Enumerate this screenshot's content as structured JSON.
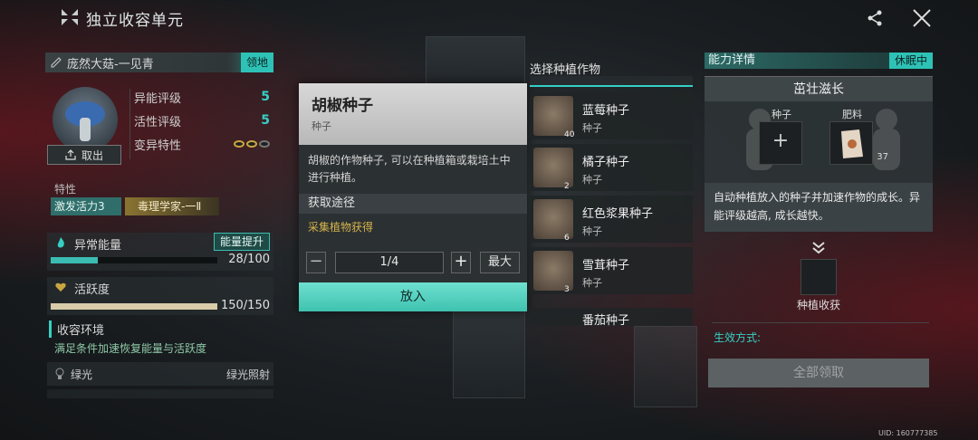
{
  "header": {
    "title": "独立收容单元"
  },
  "left": {
    "name": "庞然大菇-一见青",
    "territory_tag": "领地",
    "take_out": "取出",
    "stats": [
      {
        "label": "异能评级",
        "value": "5"
      },
      {
        "label": "活性评级",
        "value": "5"
      },
      {
        "label": "变异特性",
        "value": ""
      }
    ],
    "traits_label": "特性",
    "traits": [
      "激发活力3",
      "毒理学家-一Ⅱ"
    ],
    "energy": {
      "label": "异常能量",
      "boost": "能量提升",
      "value_text": "28/100",
      "fraction": 0.28
    },
    "activity": {
      "label": "活跃度",
      "value_text": "150/150",
      "fraction": 1.0
    },
    "env": {
      "title": "收容环境",
      "desc": "满足条件加速恢复能量与活跃度",
      "row_key": "绿光",
      "row_value": "绿光照射"
    }
  },
  "popup": {
    "name": "胡椒种子",
    "type": "种子",
    "desc": "胡椒的作物种子, 可以在种植箱或栽培土中进行种植。",
    "source_title": "获取途径",
    "source_value": "采集植物获得",
    "qty": "1/4",
    "max": "最大",
    "put": "放入"
  },
  "seeds": {
    "title": "选择种植作物",
    "items": [
      {
        "name": "蓝莓种子",
        "type": "种子",
        "count": "40"
      },
      {
        "name": "橘子种子",
        "type": "种子",
        "count": "2"
      },
      {
        "name": "红色浆果种子",
        "type": "种子",
        "count": "6"
      },
      {
        "name": "雪茸种子",
        "type": "种子",
        "count": "3"
      }
    ],
    "partial_name": "番茄种子"
  },
  "right": {
    "title": "能力详情",
    "state": "休眠中",
    "ability": "茁壮滋长",
    "seed_label": "种子",
    "fert_label": "肥料",
    "fert_count": "37",
    "desc": "自动种植放入的种子并加速作物的成长。异能评级越高, 成长越快。",
    "harvest": "种植收获",
    "effect": "生效方式:",
    "claim": "全部领取"
  },
  "uid": "UID: 160777385",
  "colors": {
    "accent": "#36d0c4",
    "gold": "#d6b34c"
  }
}
